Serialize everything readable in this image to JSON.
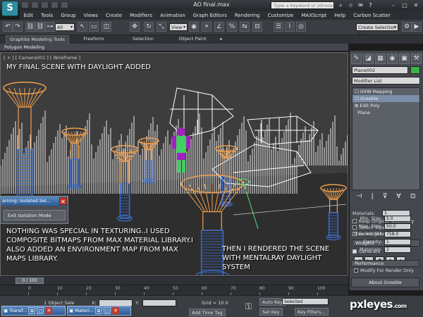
{
  "window": {
    "title": "AO final.max",
    "search_placeholder": "Type a keyword or phrase",
    "logo_glyph": "S",
    "controls": {
      "minimize": "–",
      "maximize": "□",
      "close": "✕"
    }
  },
  "menu": [
    "Edit",
    "Tools",
    "Group",
    "Views",
    "Create",
    "Modifiers",
    "Animation",
    "Graph Editors",
    "Rendering",
    "Customize",
    "MAXScript",
    "Help",
    "Carbon Scatter"
  ],
  "toolbar": {
    "selection_filter": "All",
    "ref_coord": "View",
    "named_selection": "Create Selection Se",
    "icons": [
      "undo-icon",
      "redo-icon",
      "link-icon",
      "unlink-icon",
      "bind-icon",
      "select-icon",
      "rect-select-icon",
      "window-crossing-icon",
      "move-icon",
      "rotate-icon",
      "scale-icon",
      "pivot-icon",
      "snap-icon",
      "angle-snap-icon",
      "percent-snap-icon",
      "mirror-icon",
      "align-icon",
      "layer-icon",
      "curve-editor-icon",
      "material-editor-icon",
      "render-setup-icon",
      "render-icon"
    ]
  },
  "ribbon": {
    "tabs": [
      "Graphite Modeling Tools",
      "Freeform",
      "Selection",
      "Object Paint"
    ],
    "subtab": "Polygon Modeling",
    "toggle": "◂"
  },
  "viewport": {
    "label": "[ + ] [ Camera001 ] [ Wireframe ]",
    "caption_title": "MY FINAL SCENE WITH DAYLIGHT ADDED",
    "caption_texture": "NOTHING WAS SPECIAL IN TEXTURING..I USED COMPOSITE BITMAPS FROM MAX MATERIAL LIBRARY.I ALSO ADDED AN ENVIRONMENT MAP FROM MAX MAPS LIBRARY.",
    "caption_render": "THEN I RENDERED THE SCENE WITH MENTALRAY DAYLIGHT SYSTEM",
    "colors": {
      "orange": "#f0a050",
      "blue": "#3a6fd8",
      "white": "#ffffff",
      "figure_purple": "#a020c0",
      "figure_green": "#40d060"
    }
  },
  "isolation_dialog": {
    "title": "arning: Isolated Sel...",
    "exit_button": "Exit Isolation Mode",
    "close": "✕"
  },
  "command_panel": {
    "tab_glyphs": [
      "✎",
      "◪",
      "▦",
      "◉",
      "▣",
      "⚒"
    ],
    "object_name": "Plane002",
    "object_color": "#3bb24a",
    "modifier_list_label": "Modifier List",
    "stack": [
      "UVW Mapping",
      "Greeble",
      "Edit Poly",
      "Plane"
    ],
    "stack_tool_glyphs": [
      "⊣",
      "|",
      "⊽",
      "∀",
      "⊡"
    ],
    "materials_label": "Materials:",
    "materials_top": "1",
    "checkboxes": [
      {
        "label": "Keep Original Geometry",
        "checked": false
      },
      {
        "label": "Select Tops",
        "checked": false
      },
      {
        "label": "Select Sides",
        "checked": false
      }
    ],
    "widgets_header": "Widgets",
    "generate_label": "Generate",
    "widget_glyphs": [
      "◢",
      "◣",
      "✱",
      "◆",
      "▲"
    ],
    "params": [
      {
        "label": "Min. Size:",
        "value": "5.0"
      },
      {
        "label": "Max. Size:",
        "value": "50.0"
      },
      {
        "label": "Max. Height:",
        "value": "758.0"
      },
      {
        "label": "Density:",
        "value": "1"
      },
      {
        "label": "Materials:",
        "value": "2"
      }
    ],
    "performance_header": "Performance",
    "modify_render_label": "Modify For Render Only",
    "about_button": "About Greeble"
  },
  "timeline": {
    "frame_display": "0 / 100",
    "ticks": [
      "0",
      "10",
      "20",
      "30",
      "40",
      "50",
      "60",
      "70",
      "80",
      "90",
      "100"
    ]
  },
  "statusbar": {
    "object_selected": "1 Object Sele",
    "coord_x_label": "X:",
    "coord_y_label": "Y:",
    "grid": "Grid = 10.0",
    "add_time_tag": "Add Time Tag",
    "auto_key": "Auto Key",
    "set_key": "Set Key",
    "selected": "Selected",
    "key_filters": "Key Filters...",
    "key_glyph": "⚿"
  },
  "mini_windows": [
    {
      "title": "Transf...",
      "glyph": "▣"
    },
    {
      "title": "Materi...",
      "glyph": "▣"
    }
  ],
  "mini_window_controls": {
    "restore": "⧉",
    "maximize": "□",
    "close": "✕"
  },
  "watermark": {
    "brand": "pxleyes",
    "suffix": ".com"
  }
}
